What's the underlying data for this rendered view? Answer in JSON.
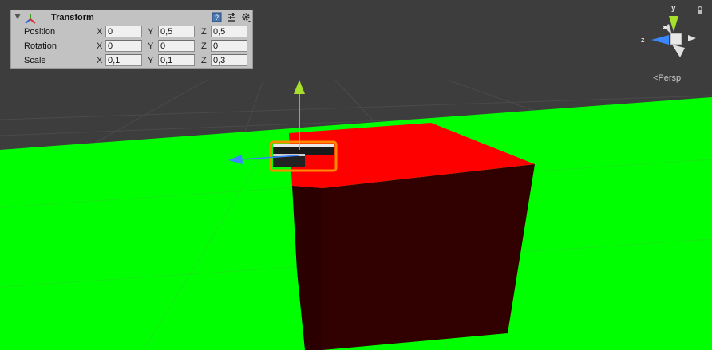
{
  "inspector": {
    "component_title": "Transform",
    "rows": [
      {
        "label": "Position",
        "x": "0",
        "y": "0,5",
        "z": "0,5"
      },
      {
        "label": "Rotation",
        "x": "0",
        "y": "0",
        "z": "0"
      },
      {
        "label": "Scale",
        "x": "0,1",
        "y": "0,1",
        "z": "0,3"
      }
    ],
    "axis_labels": {
      "x": "X",
      "y": "Y",
      "z": "Z"
    }
  },
  "scene_view": {
    "projection_label": "Persp",
    "gizmo_axes": {
      "y": "y",
      "x": "x",
      "z": "z"
    },
    "colors": {
      "background": "#3c3c3c",
      "ground": "#00ff00",
      "cube_top": "#ff0000",
      "cube_side": "#310000",
      "y_axis": "#a6e02c",
      "z_axis": "#3a87ff",
      "selection_outline": "#ff8a00"
    }
  }
}
